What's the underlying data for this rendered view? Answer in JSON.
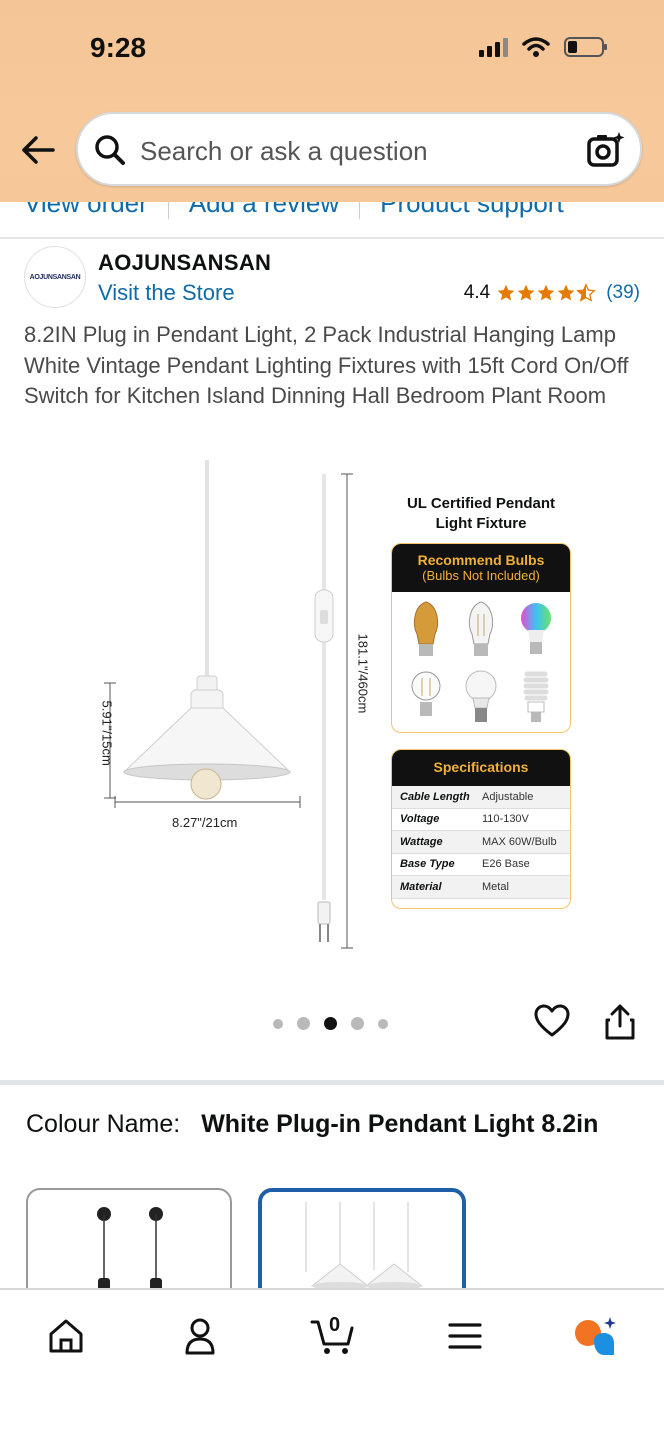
{
  "status_bar": {
    "time": "9:28"
  },
  "search": {
    "placeholder": "Search or ask a question"
  },
  "subnav": {
    "links": [
      "View order",
      "Add a review",
      "Product support"
    ]
  },
  "brand": {
    "logo_text": "AOJUNSANSAN",
    "name": "AOJUNSANSAN",
    "store_link": "Visit the Store",
    "rating": "4.4",
    "review_count": "(39)",
    "stars_value": 4.4
  },
  "product": {
    "title": "8.2IN Plug in Pendant Light, 2 Pack Industrial Hanging Lamp White Vintage Pendant Lighting Fixtures with 15ft Cord On/Off Switch for Kitchen Island Dinning Hall Bedroom Plant Room"
  },
  "image": {
    "height_dim": "5.91\"/15cm",
    "width_dim": "8.27\"/21cm",
    "cord_dim": "181.1\"/460cm",
    "ul_title": "UL Certified Pendant Light Fixture",
    "bulbs_title": "Recommend Bulbs",
    "bulbs_sub": "(Bulbs Not Included)",
    "spec_title": "Specifications",
    "specs": [
      {
        "k": "Cable Length",
        "v": "Adjustable"
      },
      {
        "k": "Voltage",
        "v": "110-130V"
      },
      {
        "k": "Wattage",
        "v": "MAX 60W/Bulb"
      },
      {
        "k": "Base Type",
        "v": "E26 Base"
      },
      {
        "k": "Material",
        "v": "Metal"
      }
    ],
    "carousel_index": 3,
    "carousel_total": 5
  },
  "colour": {
    "label": "Colour Name:",
    "value": "White Plug-in Pendant Light 8.2in"
  },
  "bottom_nav": {
    "cart_count": "0",
    "items": [
      "home-icon",
      "account-icon",
      "cart-icon",
      "menu-icon",
      "rufus-ai-icon"
    ]
  },
  "colors": {
    "link": "#0f6ba8",
    "star": "#e67a00",
    "selected_border": "#1f5fa8",
    "header": "#f5c799"
  }
}
